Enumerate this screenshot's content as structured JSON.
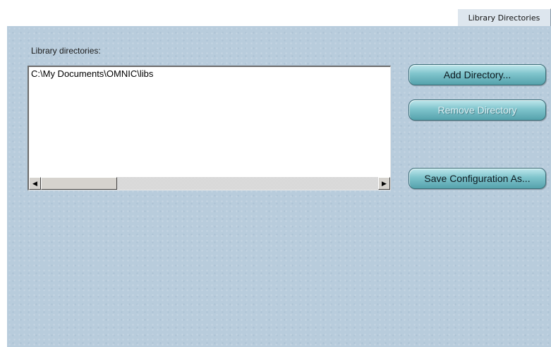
{
  "tab": {
    "label": "Library Directories"
  },
  "library": {
    "label": "Library directories:",
    "items": [
      "C:\\My Documents\\OMNIC\\libs"
    ]
  },
  "buttons": {
    "add": "Add Directory...",
    "remove": "Remove Directory",
    "save": "Save Configuration As..."
  },
  "scrollbar": {
    "left_arrow": "◀",
    "right_arrow": "▶"
  },
  "colors": {
    "panel_background": "#b8ccdc",
    "button_teal": "#7fc4cc"
  }
}
